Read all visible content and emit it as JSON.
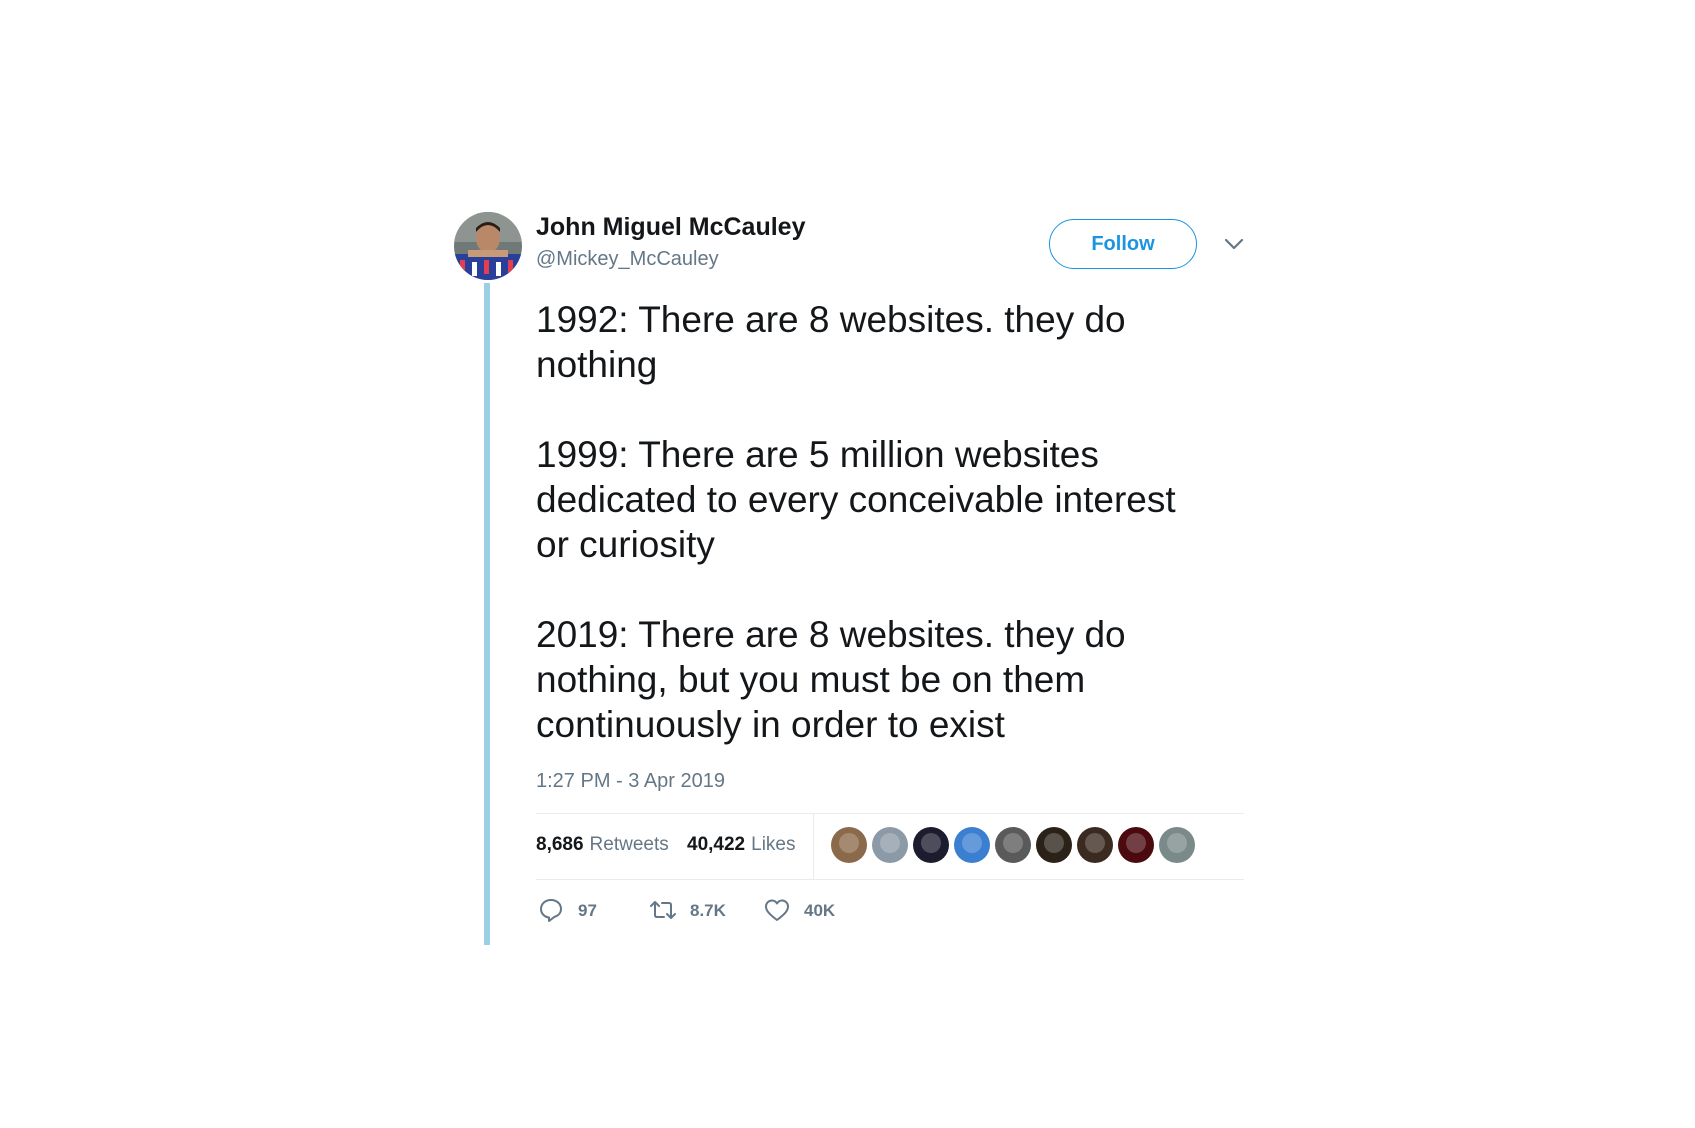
{
  "author": {
    "name": "John Miguel McCauley",
    "handle": "@Mickey_McCauley",
    "avatar_icon": "profile-photo-avatar"
  },
  "follow_button": {
    "label": "Follow",
    "color": "#1b95e0"
  },
  "menu_icon": "chevron-down-icon",
  "tweet": {
    "paragraphs": [
      [
        "1992: There are 8 websites. they do",
        "nothing"
      ],
      [
        "1999: There are 5 million websites",
        "dedicated to every conceivable interest",
        "or curiosity"
      ],
      [
        "2019: There are 8 websites. they do",
        "nothing, but you must be on them",
        "continuously in order to exist"
      ]
    ],
    "timestamp": "1:27 PM - 3 Apr 2019"
  },
  "stats": {
    "retweets_count": "8,686",
    "retweets_label": "Retweets",
    "likes_count": "40,422",
    "likes_label": "Likes"
  },
  "liked_by_avatars": [
    {
      "icon": "liker-avatar-1",
      "color": "#8a6a4a"
    },
    {
      "icon": "liker-avatar-2",
      "color": "#8c9aa8"
    },
    {
      "icon": "liker-avatar-3",
      "color": "#1c1c2e"
    },
    {
      "icon": "liker-avatar-4-texas",
      "color": "#3b7fd1"
    },
    {
      "icon": "liker-avatar-5",
      "color": "#5a5a5a"
    },
    {
      "icon": "liker-avatar-6",
      "color": "#2a2218"
    },
    {
      "icon": "liker-avatar-7",
      "color": "#3a2a20"
    },
    {
      "icon": "liker-avatar-8",
      "color": "#4a0a10"
    },
    {
      "icon": "liker-avatar-9",
      "color": "#7a8a88"
    }
  ],
  "actions": {
    "reply": {
      "icon": "reply-icon",
      "count": "97"
    },
    "retweet": {
      "icon": "retweet-icon",
      "count": "8.7K"
    },
    "like": {
      "icon": "heart-icon",
      "count": "40K"
    }
  },
  "colors": {
    "thread_line": "#9ccfe6",
    "text": "#14171a",
    "muted": "#657786",
    "divider": "#e6ecf0"
  }
}
